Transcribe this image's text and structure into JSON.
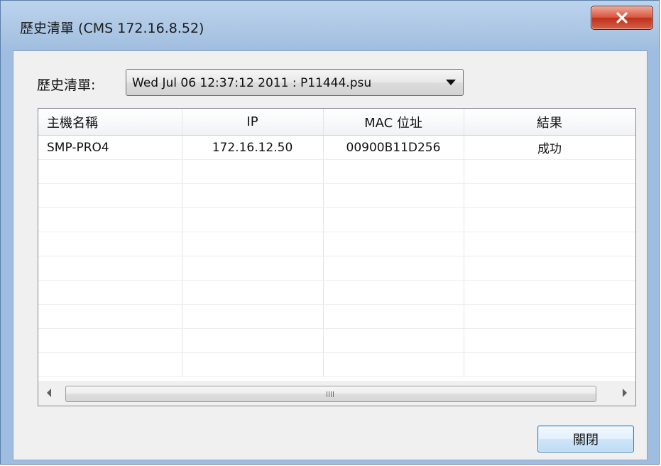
{
  "window": {
    "title": "歷史清單 (CMS  172.16.8.52)"
  },
  "history": {
    "label": "歷史清單:",
    "selected": "Wed Jul 06 12:37:12 2011 : P11444.psu"
  },
  "table": {
    "columns": [
      "主機名稱",
      "IP",
      "MAC 位址",
      "結果"
    ],
    "rows": [
      [
        "SMP-PRO4",
        "172.16.12.50",
        "00900B11D256",
        "成功"
      ]
    ]
  },
  "buttons": {
    "close_label": "關閉"
  },
  "icons": {
    "close": "close-x-icon",
    "scroll_left": "scroll-left-arrow-icon",
    "scroll_right": "scroll-right-arrow-icon",
    "dropdown": "dropdown-arrow-icon"
  },
  "colors": {
    "close_accent": "#c7402a",
    "button_border": "#3c7fb1"
  }
}
